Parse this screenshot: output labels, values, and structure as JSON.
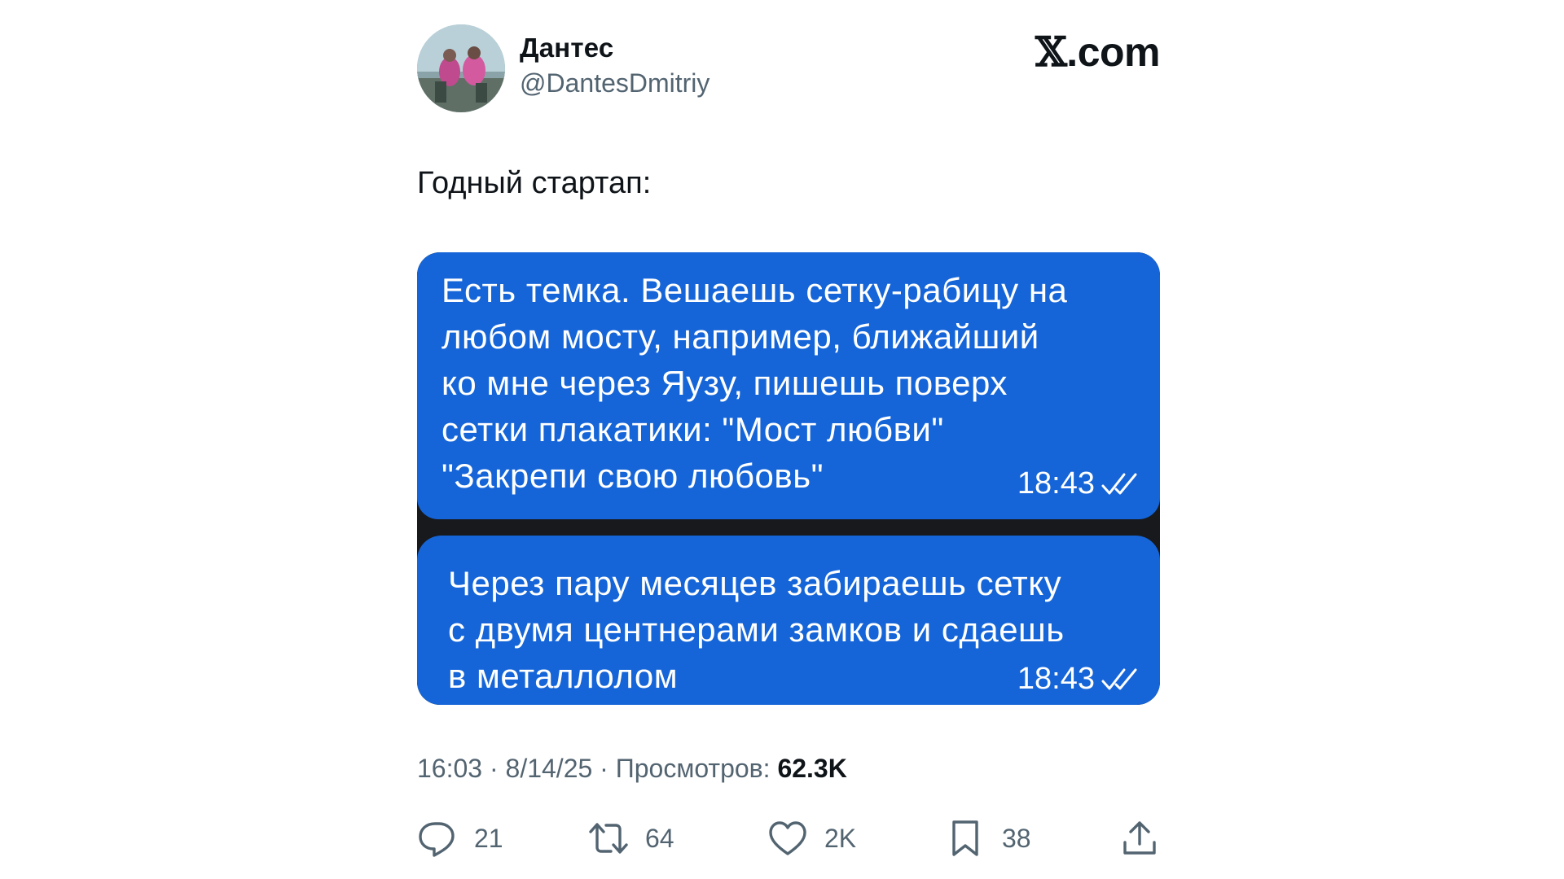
{
  "author": {
    "name": "Дантес",
    "handle": "@DantesDmitriy"
  },
  "site_logo": {
    "glyph": "𝕏",
    "suffix": ".com"
  },
  "tweet_text": "Годный стартап:",
  "messages": [
    {
      "text": "Есть темка. Вешаешь сетку-рабицу на\nлюбом мосту, например, ближайший\nко мне через Яузу, пишешь поверх\nсетки плакатики: \"Мост любви\"\n\"Закрепи свою любовь\"",
      "time": "18:43",
      "status_icon": "double-check-icon"
    },
    {
      "text": "Через пару месяцев забираешь сетку\nс двумя центнерами замков и сдаешь\nв металлолом",
      "time": "18:43",
      "status_icon": "double-check-icon"
    }
  ],
  "meta": {
    "time": "16:03",
    "sep1": " · ",
    "date": "8/14/25",
    "sep2": " · ",
    "views_label": "Просмотров: ",
    "views_count": "62.3K"
  },
  "actions": {
    "replies": "21",
    "retweets": "64",
    "likes": "2K",
    "bookmarks": "38"
  },
  "colors": {
    "bubble": "#1565d8",
    "media_background": "#17191c",
    "secondary_text": "#536471",
    "primary_text": "#0f1419"
  }
}
